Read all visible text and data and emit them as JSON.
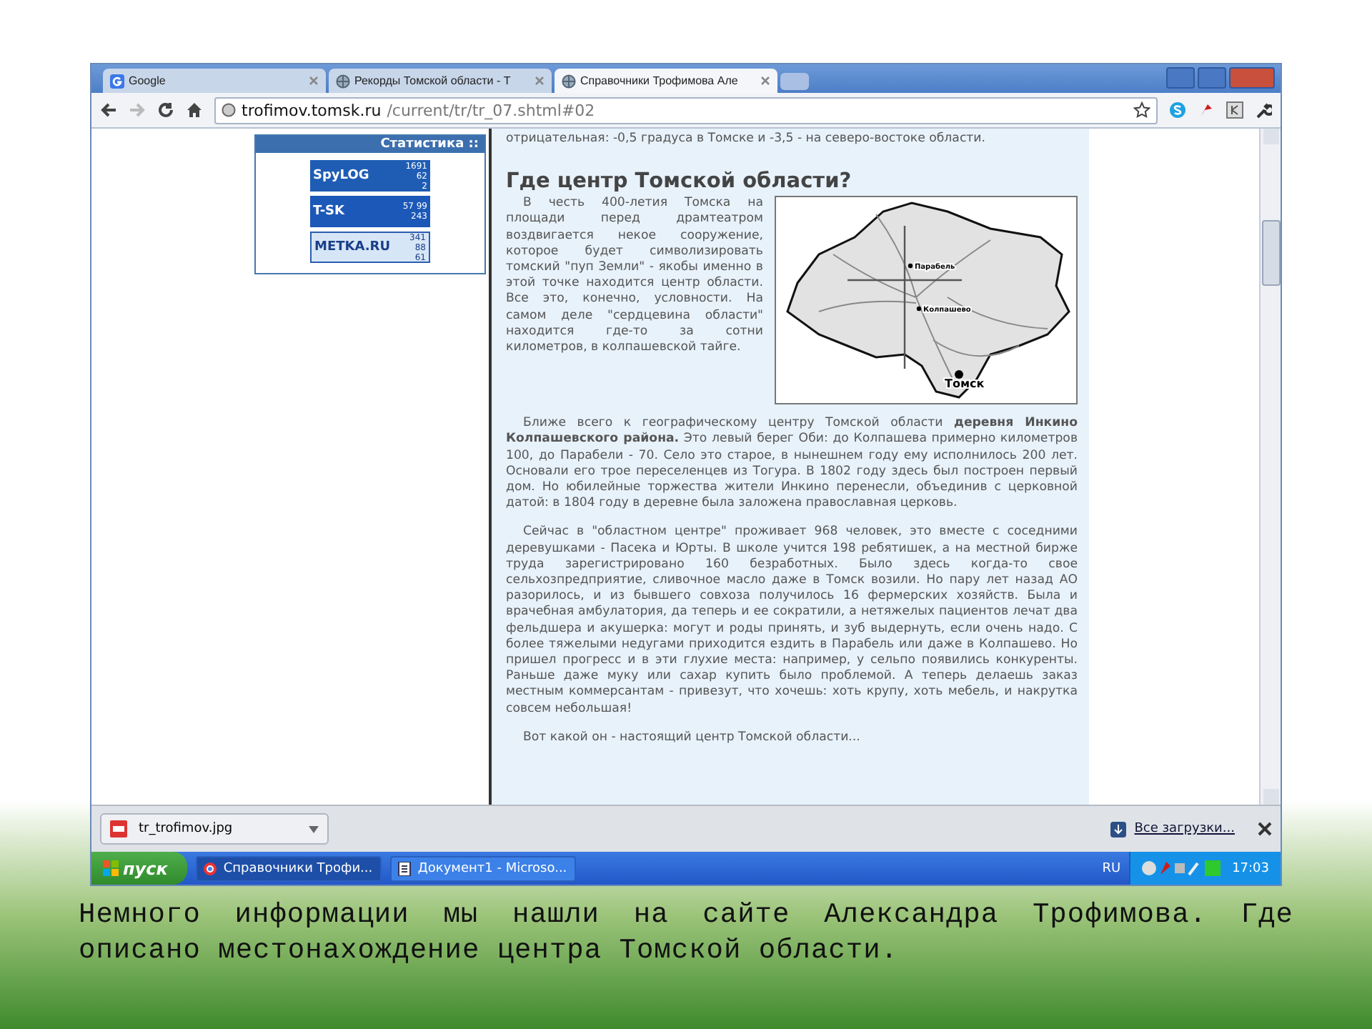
{
  "browser": {
    "tabs": [
      {
        "label": "Google",
        "selected": false
      },
      {
        "label": "Рекорды Томской области - Т",
        "selected": false
      },
      {
        "label": "Справочники Трофимова Але",
        "selected": true
      }
    ],
    "address": {
      "host": "trofimov.tomsk.ru",
      "path": "/current/tr/tr_07.shtml#02"
    }
  },
  "stats": {
    "title": "Статистика ::",
    "counters": [
      {
        "kind": "spylog",
        "logo": "SpyLOG",
        "numbers": [
          "1691",
          "62",
          "2"
        ]
      },
      {
        "kind": "tsk",
        "logo": "T-SK",
        "numbers": [
          "57 99",
          "243"
        ]
      },
      {
        "kind": "metka",
        "logo": "METKA.RU",
        "numbers": [
          "341",
          "88",
          "61"
        ]
      }
    ]
  },
  "article": {
    "intro": "отрицательная: -0,5 градуса в Томске и -3,5 - на северо-востоке области.",
    "heading": "Где центр Томской области?",
    "paragraphs": [
      "В честь 400-летия Томска на площади перед драмтеатром воздвигается некое сооружение, которое будет символизировать томский \"пуп Земли\" - якобы именно в этой точке находится центр области. Все это, конечно, условности. На самом деле \"сердцевина области\" находится где-то за сотни километров, в колпашевской тайге.",
      "Ближе всего к географическому центру Томской области **деревня Инкино Колпашевского района.** Это левый берег Оби: до Колпашева примерно километров 100, до Парабели - 70. Село это старое, в нынешнем году ему исполнилось 200 лет. Основали его трое переселенцев из Тогура. В 1802 году здесь был построен первый дом. Но юбилейные торжества жители Инкино перенесли, объединив с церковной датой: в 1804 году в деревне была заложена православная церковь.",
      "Сейчас в \"областном центре\" проживает 968 человек, это вместе с соседними деревушками - Пасека и Юрты. В школе учится 198 ребятишек, а на местной бирже труда зарегистрировано 160 безработных. Было здесь когда-то свое сельхозпредприятие, сливочное масло даже в Томск возили. Но пару лет назад АО разорилось, и из бывшего совхоза получилось 16 фермерских хозяйств. Была и врачебная амбулатория, да теперь и ее сократили, а нетяжелых пациентов лечат два фельдшера и акушерка: могут и роды принять, и зуб выдернуть, если очень надо. С более тяжелыми недугами приходится ездить в Парабель или даже в Колпашево. Но пришел прогресс и в эти глухие места: например, у сельпо появились конкуренты. Раньше даже муку или сахар купить было проблемой. А теперь делаешь заказ местным коммерсантам - привезут, что хочешь: хоть крупу, хоть мебель, и накрутка совсем небольшая!",
      "Вот какой он - настоящий центр Томской области..."
    ],
    "map": {
      "places": [
        {
          "name": "Парабель",
          "kind": "town"
        },
        {
          "name": "Колпашево",
          "kind": "town"
        },
        {
          "name": "Томск",
          "kind": "city"
        }
      ]
    }
  },
  "downloads": {
    "file": "tr_trofimov.jpg",
    "link": "Все загрузки..."
  },
  "taskbar": {
    "start": "пуск",
    "buttons": [
      {
        "label": "Справочники Трофи...",
        "selected": true
      },
      {
        "label": "Документ1 - Microso...",
        "selected": false
      }
    ],
    "lang": "RU",
    "clock": "17:03"
  },
  "caption": "Немного информации мы нашли на сайте Александра Трофимова. Где описано местонахождение центра Томской области."
}
